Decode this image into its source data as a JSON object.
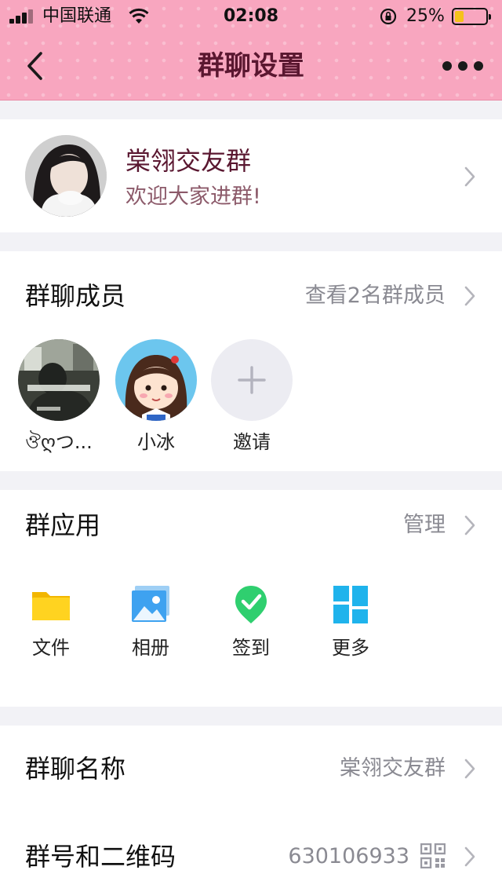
{
  "status_bar": {
    "carrier": "中国联通",
    "time": "02:08",
    "battery_text": "25%",
    "battery_level": 0.25
  },
  "nav": {
    "title": "群聊设置"
  },
  "group": {
    "name": "棠翎交友群",
    "description": "欢迎大家进群!"
  },
  "members": {
    "label": "群聊成员",
    "view_all": "查看2名群成员",
    "items": [
      {
        "name": "ঔღつ..."
      },
      {
        "name": "小冰"
      }
    ],
    "invite_label": "邀请"
  },
  "apps": {
    "label": "群应用",
    "manage": "管理",
    "items": [
      {
        "label": "文件",
        "icon": "folder-icon"
      },
      {
        "label": "相册",
        "icon": "album-icon"
      },
      {
        "label": "签到",
        "icon": "checkin-icon"
      },
      {
        "label": "更多",
        "icon": "more-apps-icon"
      }
    ]
  },
  "settings": {
    "group_name_label": "群聊名称",
    "group_name_value": "棠翎交友群",
    "group_id_label": "群号和二维码",
    "group_id_value": "630106933"
  },
  "colors": {
    "header_pink": "#f8a6bf",
    "title_maroon": "#5a1730",
    "checkin_green": "#2fcf6f",
    "tile_blue": "#1fb3ec"
  }
}
